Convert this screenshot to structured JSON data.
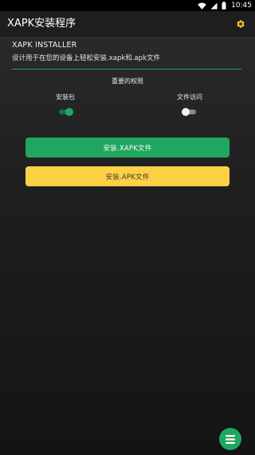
{
  "status_bar": {
    "time": "10:45",
    "icons": [
      "wifi-icon",
      "cellular-signal-icon",
      "battery-icon"
    ]
  },
  "app_bar": {
    "title": "XAPK安装程序",
    "settings_icon": "gear-icon"
  },
  "installer": {
    "heading": "XAPK INSTALLER",
    "description": "设计用于在您的设备上轻松安装.xapk和.apk文件"
  },
  "permissions": {
    "title": "重要的权限",
    "items": [
      {
        "label": "安装包",
        "enabled": true
      },
      {
        "label": "文件访问",
        "enabled": false
      }
    ]
  },
  "actions": {
    "install_xapk": "安装.XAPK文件",
    "install_apk": "安装.APK文件"
  },
  "fab": {
    "icon": "menu-list-icon"
  },
  "colors": {
    "accent_green": "#1fa65f",
    "accent_yellow": "#fdd146",
    "toggle_off_thumb": "#f4f4f4",
    "background": "#1e1e1e"
  }
}
